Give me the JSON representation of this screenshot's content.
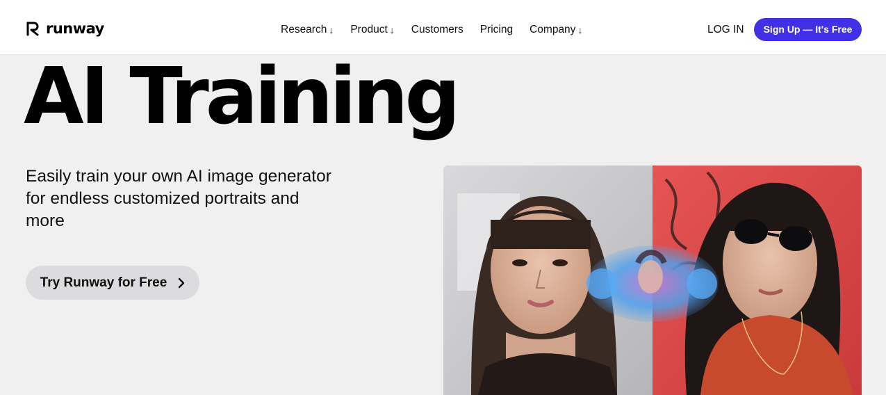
{
  "header": {
    "brand": "runway",
    "nav": [
      {
        "label": "Research",
        "arrow": "↓"
      },
      {
        "label": "Product",
        "arrow": "↓"
      },
      {
        "label": "Customers",
        "arrow": ""
      },
      {
        "label": "Pricing",
        "arrow": ""
      },
      {
        "label": "Company",
        "arrow": "↓"
      }
    ],
    "login_label": "LOG IN",
    "signup_label": "Sign Up — It's Free"
  },
  "hero": {
    "title": "AI Training",
    "subtitle": "Easily train your own AI image generator for endless customized portraits and more",
    "cta_label": "Try Runway for Free"
  },
  "colors": {
    "accent": "#4230e6",
    "page_background": "#f0f0f0",
    "cta_background": "#dcdcdf"
  }
}
